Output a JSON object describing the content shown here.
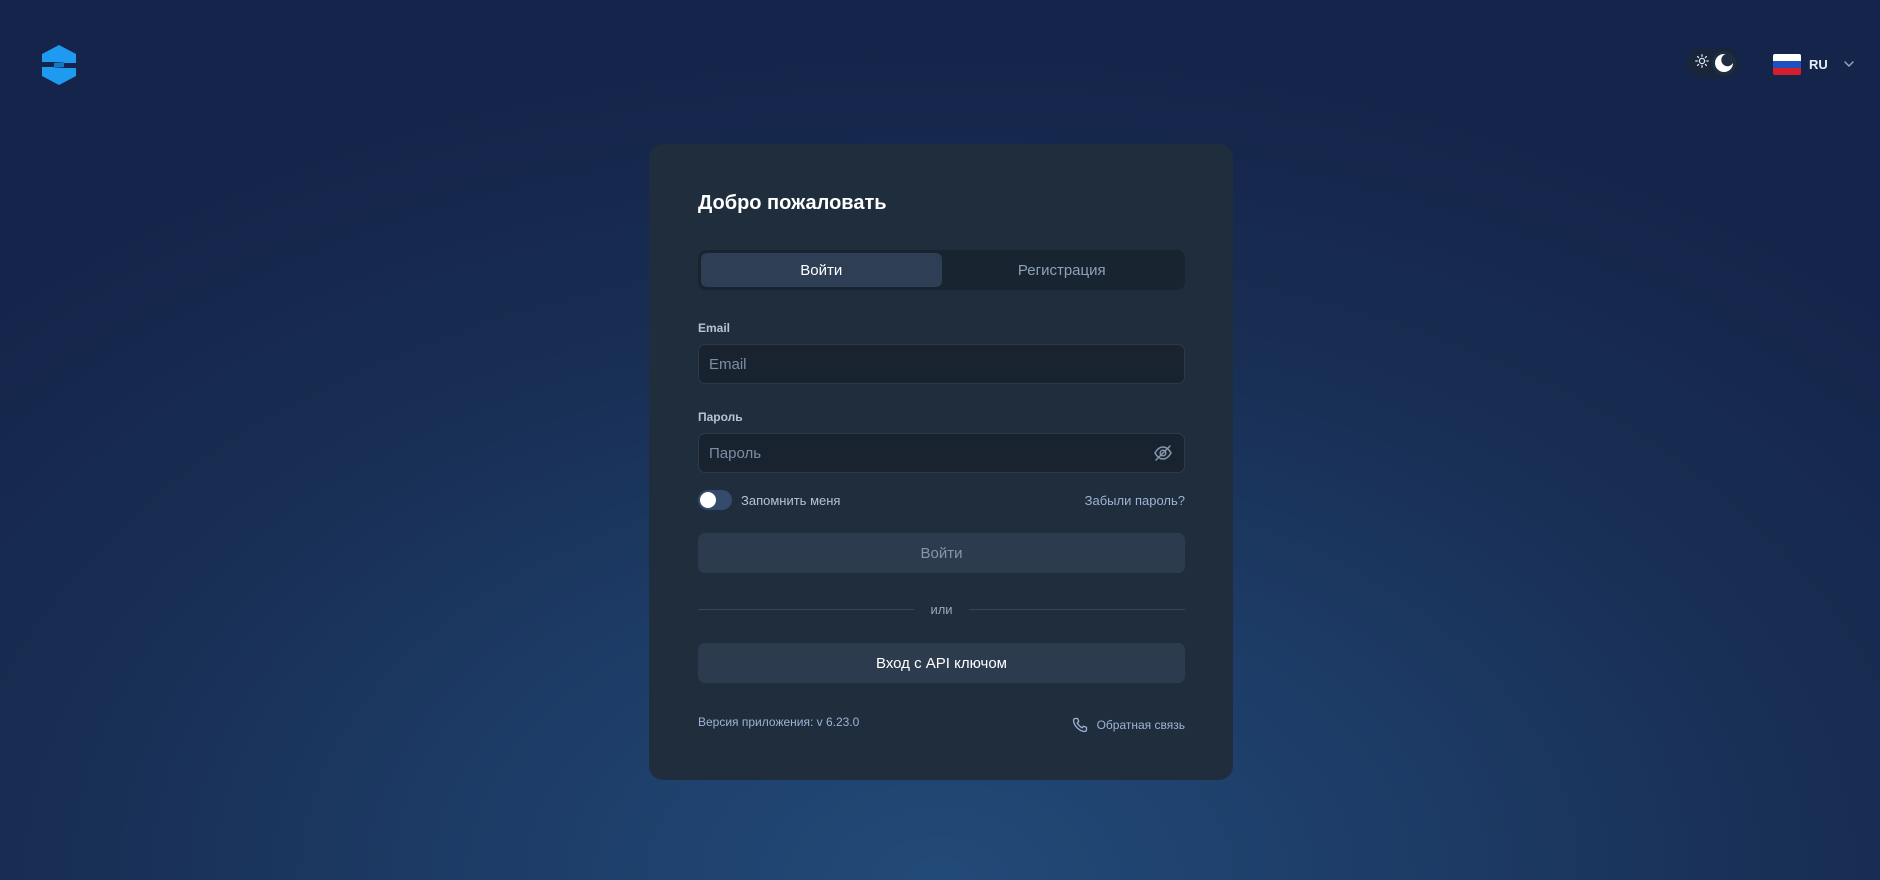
{
  "header": {
    "logo_icon": "stylized-s-logo",
    "theme": {
      "light_icon": "sun-icon",
      "dark_icon": "moon-icon",
      "active": "dark"
    },
    "language": {
      "code": "RU",
      "flag": "russia-flag-icon"
    }
  },
  "card": {
    "title": "Добро пожаловать",
    "tabs": [
      {
        "label": "Войти",
        "active": true
      },
      {
        "label": "Регистрация",
        "active": false
      }
    ],
    "email": {
      "label": "Email",
      "placeholder": "Email",
      "value": ""
    },
    "password": {
      "label": "Пароль",
      "placeholder": "Пароль",
      "value": ""
    },
    "remember_label": "Запомнить меня",
    "remember_on": false,
    "forgot_label": "Забыли пароль?",
    "login_button": "Войти",
    "divider_text": "или",
    "api_button": "Вход с API ключом",
    "version_text": "Версия приложения: v 6.23.0",
    "feedback_label": "Обратная связь"
  },
  "colors": {
    "accent_logo": "#1e9bf0",
    "card_bg": "#1f2d3d",
    "input_bg": "#18232f",
    "button_bg": "#2c3b4d"
  }
}
